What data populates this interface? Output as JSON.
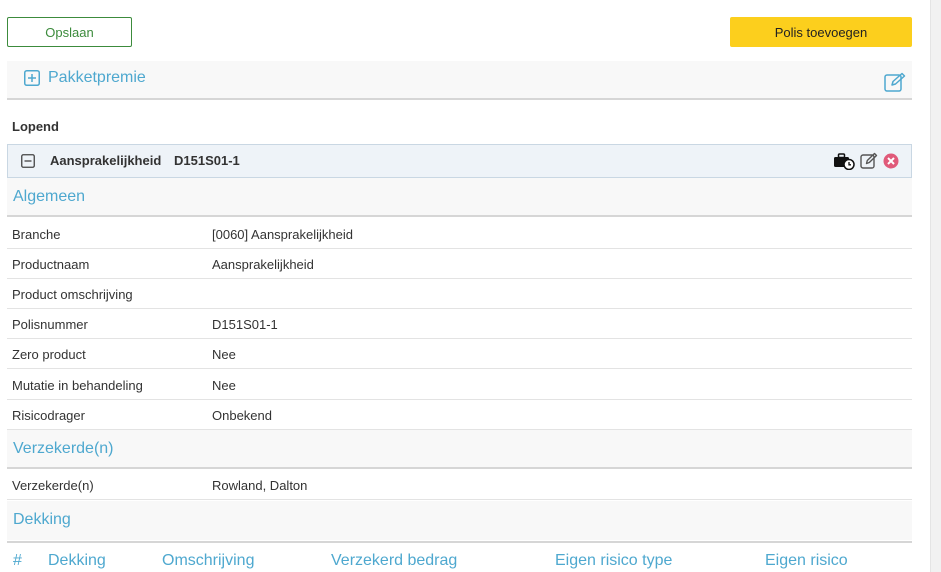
{
  "toolbar": {
    "save_label": "Opslaan",
    "add_policy_label": "Polis toevoegen"
  },
  "package": {
    "title": "Pakketpremie"
  },
  "status_label": "Lopend",
  "policy": {
    "name": "Aansprakelijkheid",
    "number": "D151S01-1"
  },
  "sections": {
    "general": {
      "title": "Algemeen",
      "rows": [
        {
          "label": "Branche",
          "value": "[0060] Aansprakelijkheid"
        },
        {
          "label": "Productnaam",
          "value": "Aansprakelijkheid"
        },
        {
          "label": "Product omschrijving",
          "value": ""
        },
        {
          "label": "Polisnummer",
          "value": "D151S01-1"
        },
        {
          "label": "Zero product",
          "value": "Nee"
        },
        {
          "label": "Mutatie in behandeling",
          "value": "Nee"
        },
        {
          "label": "Risicodrager",
          "value": "Onbekend"
        }
      ]
    },
    "insured": {
      "title": "Verzekerde(n)",
      "rows": [
        {
          "label": "Verzekerde(n)",
          "value": "Rowland, Dalton"
        }
      ]
    },
    "coverage": {
      "title": "Dekking",
      "columns": [
        "#",
        "Dekking",
        "Omschrijving",
        "Verzekerd bedrag",
        "Eigen risico type",
        "Eigen risico"
      ]
    }
  },
  "icons": {
    "plus": "plus-square-icon",
    "edit": "edit-icon",
    "minus": "minus-square-icon",
    "briefcase": "briefcase-clock-icon",
    "delete": "delete-circle-icon"
  },
  "colors": {
    "accent": "#4ea8cf",
    "save_border": "#3c8b3c",
    "add_button": "#fccf1d",
    "delete": "#e05a7a"
  }
}
